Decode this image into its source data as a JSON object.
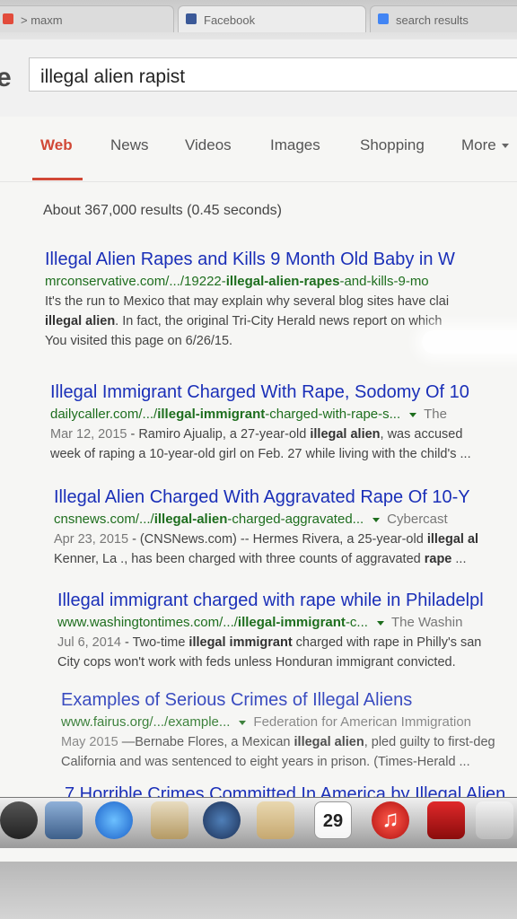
{
  "browser": {
    "tabs": [
      {
        "label": "> maxm"
      },
      {
        "label": "Facebook"
      },
      {
        "label": "search results"
      }
    ]
  },
  "search": {
    "logo_letter": "e",
    "query": "illegal alien rapist"
  },
  "nav": {
    "items": [
      {
        "label": "Web"
      },
      {
        "label": "News"
      },
      {
        "label": "Videos"
      },
      {
        "label": "Images"
      },
      {
        "label": "Shopping"
      },
      {
        "label": "More"
      }
    ]
  },
  "stats": "About 367,000 results (0.45 seconds)",
  "results": [
    {
      "title": "Illegal Alien Rapes and Kills 9 Month Old Baby in W",
      "url_pre": "mrconservative.com/.../19222-",
      "url_bold": "illegal-alien-rapes",
      "url_post": "-and-kills-9-mo",
      "source": "",
      "line1": "It's the run to Mexico that may explain why several blog sites have clai",
      "line2_bold": "illegal alien",
      "line2": ". In fact, the original Tri-City Herald news report on which",
      "line3": "You visited this page on 6/26/15."
    },
    {
      "title": "Illegal Immigrant Charged With Rape, Sodomy Of 10",
      "url_pre": "dailycaller.com/.../",
      "url_bold": "illegal-immigrant",
      "url_post": "-charged-with-rape-s...",
      "source": "The",
      "date": "Mar 12, 2015",
      "line1_a": " - Ramiro Ajualip, a 27-year-old ",
      "line1_bold": "illegal alien",
      "line1_b": ", was accused",
      "line2": "week of raping a 10-year-old girl on Feb. 27 while living with the child's ..."
    },
    {
      "title": "Illegal Alien Charged With Aggravated Rape Of 10-Y",
      "url_pre": "cnsnews.com/.../",
      "url_bold": "illegal-alien",
      "url_post": "-charged-aggravated...",
      "source": "Cybercast",
      "date": "Apr 23, 2015",
      "line1_a": " - (CNSNews.com) -- Hermes Rivera, a 25-year-old ",
      "line1_bold": "illegal al",
      "line2_a": "Kenner, La ., has been charged with three counts of aggravated ",
      "line2_bold": "rape",
      "line2_b": " ..."
    },
    {
      "title": "Illegal immigrant charged with rape while in Philadelpl",
      "url_pre": "www.washingtontimes.com/.../",
      "url_bold": "illegal-immigrant",
      "url_post": "-c...",
      "source": "The Washin",
      "date": "Jul 6, 2014",
      "line1_a": " - Two-time ",
      "line1_bold": "illegal immigrant",
      "line1_b": " charged with rape in Philly's san",
      "line2": "City cops won't work with feds unless Honduran immigrant convicted."
    },
    {
      "title": "Examples of Serious Crimes of Illegal Aliens",
      "url_pre": "www.fairus.org/.../example...",
      "url_bold": "",
      "url_post": "",
      "source": "Federation for American Immigration",
      "date": "May 2015",
      "line1_a": " —Bernabe Flores, a Mexican ",
      "line1_bold": "illegal alien",
      "line1_b": ", pled guilty to first-deg",
      "line2": "California and was sentenced to eight years in prison. (Times-Herald ..."
    },
    {
      "title": "7 Horrible Crimes Committed In America by Illegal Alien"
    }
  ],
  "dock": {
    "calendar_day": "29"
  },
  "colors": {
    "link": "#1a2fb8",
    "url": "#1e6e1e",
    "active_tab": "#d14836"
  }
}
